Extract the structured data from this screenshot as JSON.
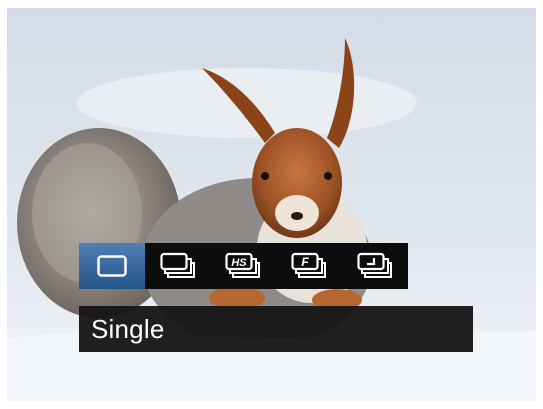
{
  "mode_bar": {
    "buttons": [
      {
        "icon": "single-frame-icon",
        "selected": true
      },
      {
        "icon": "continuous-shot-icon",
        "selected": false
      },
      {
        "icon": "high-speed-burst-icon",
        "selected": false,
        "glyph": "HS"
      },
      {
        "icon": "fast-burst-icon",
        "selected": false,
        "glyph": "F"
      },
      {
        "icon": "self-timer-burst-icon",
        "selected": false
      }
    ],
    "accent_color": "#2f5f95"
  },
  "label": {
    "text": "Single"
  }
}
